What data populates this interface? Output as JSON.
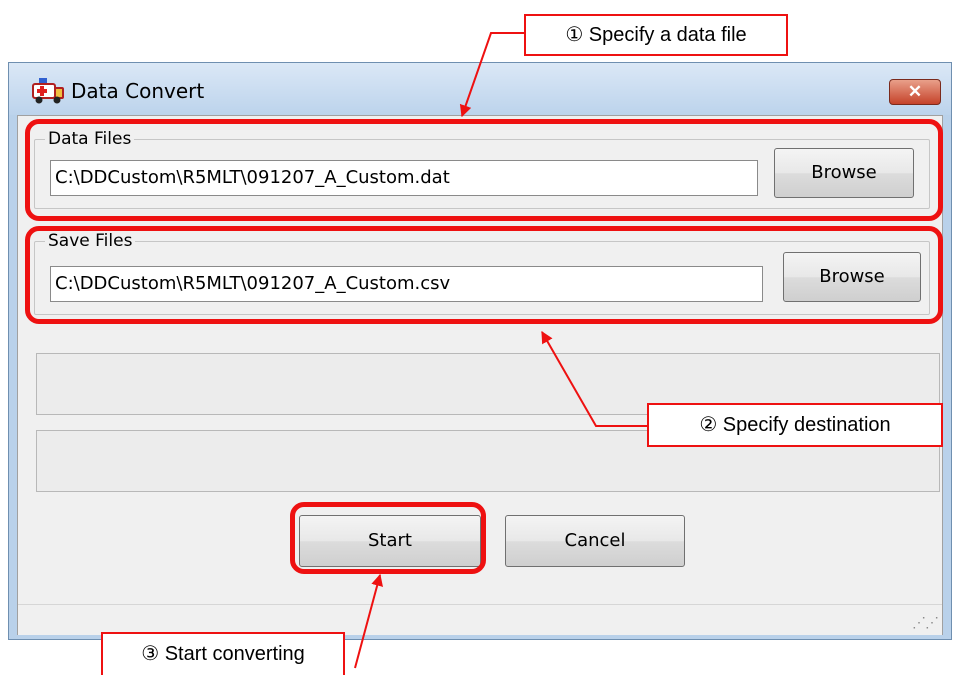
{
  "window": {
    "title": "Data Convert",
    "close_label": "✕"
  },
  "data_files": {
    "label": "Data Files",
    "path": "C:\\DDCustom\\R5MLT\\091207_A_Custom.dat",
    "browse_label": "Browse"
  },
  "save_files": {
    "label": "Save Files",
    "path": "C:\\DDCustom\\R5MLT\\091207_A_Custom.csv",
    "browse_label": "Browse"
  },
  "buttons": {
    "start_label": "Start",
    "cancel_label": "Cancel"
  },
  "annotations": {
    "step1": "① Specify a data file",
    "step2": "② Specify destination",
    "step3": "③ Start converting"
  },
  "colors": {
    "annotation": "#ee1111",
    "window_frame": "#b9d1ea",
    "client": "#f0f0f0"
  },
  "icons": {
    "app": "ambulance-icon",
    "close": "close-icon",
    "grip": "resize-grip-icon"
  }
}
